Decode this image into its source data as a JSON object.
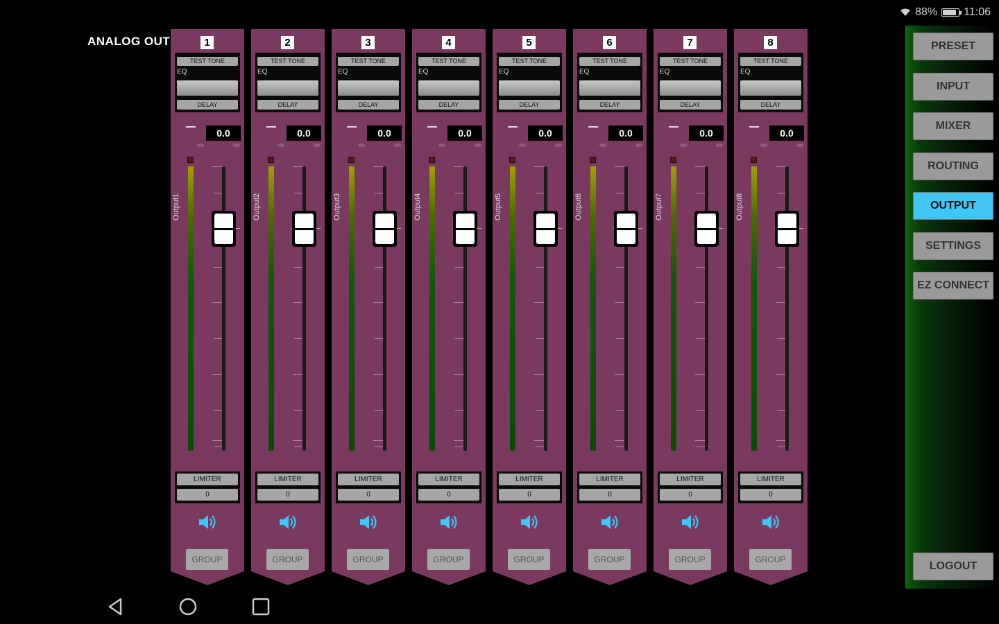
{
  "status": {
    "battery": "88%",
    "time": "11:06"
  },
  "section_title": "ANALOG OUT",
  "strips": [
    {
      "num": "1",
      "test_tone": "TEST TONE",
      "eq": "EQ",
      "delay": "DELAY",
      "db": "0.0",
      "name": "Output1",
      "limiter": "LIMITER",
      "lim_value": "0",
      "group": "GROUP"
    },
    {
      "num": "2",
      "test_tone": "TEST TONE",
      "eq": "EQ",
      "delay": "DELAY",
      "db": "0.0",
      "name": "Output2",
      "limiter": "LIMITER",
      "lim_value": "0",
      "group": "GROUP"
    },
    {
      "num": "3",
      "test_tone": "TEST TONE",
      "eq": "EQ",
      "delay": "DELAY",
      "db": "0.0",
      "name": "Output3",
      "limiter": "LIMITER",
      "lim_value": "0",
      "group": "GROUP"
    },
    {
      "num": "4",
      "test_tone": "TEST TONE",
      "eq": "EQ",
      "delay": "DELAY",
      "db": "0.0",
      "name": "Output4",
      "limiter": "LIMITER",
      "lim_value": "0",
      "group": "GROUP"
    },
    {
      "num": "5",
      "test_tone": "TEST TONE",
      "eq": "EQ",
      "delay": "DELAY",
      "db": "0.0",
      "name": "Output5",
      "limiter": "LIMITER",
      "lim_value": "0",
      "group": "GROUP"
    },
    {
      "num": "6",
      "test_tone": "TEST TONE",
      "eq": "EQ",
      "delay": "DELAY",
      "db": "0.0",
      "name": "Output6",
      "limiter": "LIMITER",
      "lim_value": "0",
      "group": "GROUP"
    },
    {
      "num": "7",
      "test_tone": "TEST TONE",
      "eq": "EQ",
      "delay": "DELAY",
      "db": "0.0",
      "name": "Output7",
      "limiter": "LIMITER",
      "lim_value": "0",
      "group": "GROUP"
    },
    {
      "num": "8",
      "test_tone": "TEST TONE",
      "eq": "EQ",
      "delay": "DELAY",
      "db": "0.0",
      "name": "Output8",
      "limiter": "LIMITER",
      "lim_value": "0",
      "group": "GROUP"
    }
  ],
  "nav": {
    "items": [
      "PRESET",
      "INPUT",
      "MIXER",
      "ROUTING",
      "OUTPUT",
      "SETTINGS",
      "EZ CONNECT"
    ],
    "active": "OUTPUT",
    "logout": "LOGOUT"
  },
  "colors": {
    "strip": "#7a3a5f",
    "active": "#3fc6f4",
    "speaker": "#3fc6f4"
  },
  "icons": {
    "back": "back-icon",
    "home": "home-icon",
    "recents": "recents-icon",
    "speaker": "speaker-icon"
  }
}
